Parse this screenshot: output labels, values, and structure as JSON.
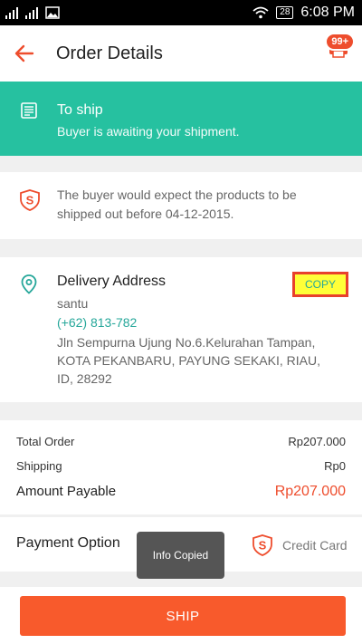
{
  "status_bar": {
    "time": "6:08 PM",
    "battery": "28"
  },
  "header": {
    "title": "Order Details",
    "badge": "99+"
  },
  "order_status": {
    "title": "To ship",
    "subtitle": "Buyer is awaiting your shipment."
  },
  "notice": {
    "text": "The buyer would expect the products to be shipped out before 04-12-2015."
  },
  "delivery": {
    "title": "Delivery Address",
    "copy_label": "COPY",
    "name": "santu",
    "phone": "(+62) 813-782",
    "address": "Jln Sempurna Ujung No.6.Kelurahan Tampan, KOTA PEKANBARU, PAYUNG SEKAKI, RIAU, ID, 28292"
  },
  "totals": {
    "total_order_label": "Total Order",
    "total_order_value": "Rp207.000",
    "shipping_label": "Shipping",
    "shipping_value": "Rp0",
    "amount_payable_label": "Amount Payable",
    "amount_payable_value": "Rp207.000"
  },
  "payment": {
    "label": "Payment Option",
    "value": "Credit Card"
  },
  "toast": "Info Copied",
  "footer": {
    "ship_label": "SHIP"
  },
  "colors": {
    "accent": "#ee4d2d",
    "teal": "#26c1a0",
    "link": "#26a79a"
  }
}
